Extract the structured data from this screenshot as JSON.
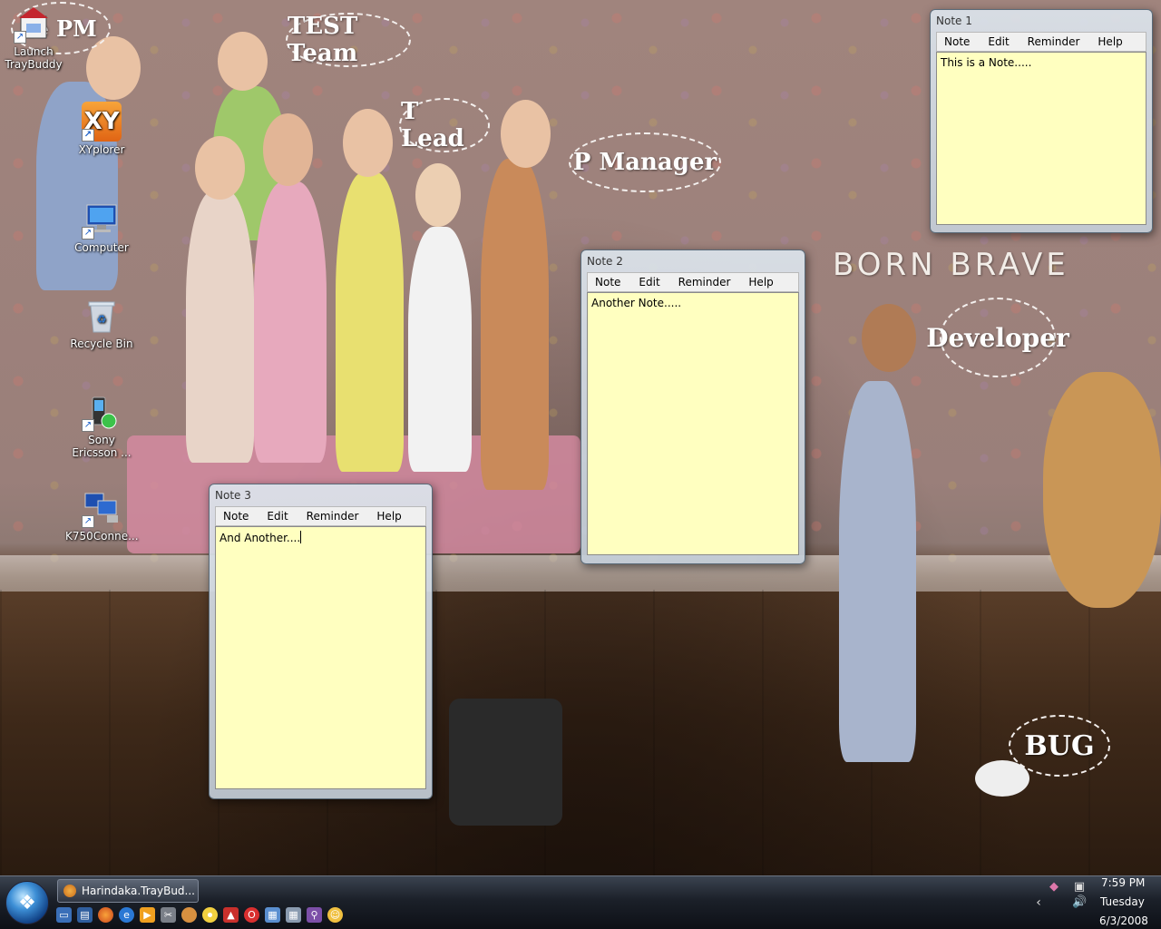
{
  "desktop": {
    "icons": [
      {
        "id": "traybuddy",
        "label": "Launch TrayBuddy"
      },
      {
        "id": "xyplorer",
        "label": "XYplorer",
        "glyph": "XY"
      },
      {
        "id": "computer",
        "label": "Computer"
      },
      {
        "id": "recycle",
        "label": "Recycle Bin"
      },
      {
        "id": "sony",
        "label": "Sony Ericsson ..."
      },
      {
        "id": "k750",
        "label": "K750Conne..."
      }
    ],
    "wallpaper_text": {
      "bubble_pm": "te PM",
      "bubble_test": "TEST Team",
      "bubble_lead": "T Lead",
      "bubble_manager": "P Manager",
      "caption": "BORN BRAVE",
      "bubble_developer": "Developer",
      "bubble_bug": "BUG"
    }
  },
  "notes": [
    {
      "title": "Note 1",
      "menu": [
        "Note",
        "Edit",
        "Reminder",
        "Help"
      ],
      "content": "This is a Note....."
    },
    {
      "title": "Note 2",
      "menu": [
        "Note",
        "Edit",
        "Reminder",
        "Help"
      ],
      "content": "Another Note....."
    },
    {
      "title": "Note 3",
      "menu": [
        "Note",
        "Edit",
        "Reminder",
        "Help"
      ],
      "content": "And Another...."
    }
  ],
  "taskbar": {
    "task_label": "Harindaka.TrayBud...",
    "quick_launch_icons": [
      "show-desktop-icon",
      "switch-windows-icon",
      "firefox-icon",
      "ie-icon",
      "media-player-icon",
      "tools-icon",
      "app-icon",
      "cd-icon",
      "paint-icon",
      "opera-icon",
      "table-icon",
      "calc-icon",
      "search-icon",
      "messenger-icon"
    ],
    "clock": {
      "time": "7:59 PM",
      "day": "Tuesday",
      "date": "6/3/2008"
    }
  }
}
